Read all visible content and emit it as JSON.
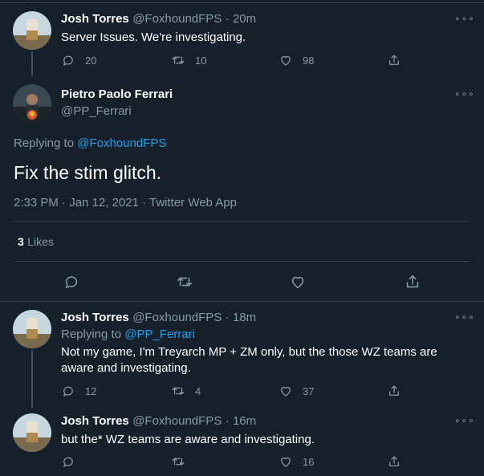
{
  "tweets": [
    {
      "name": "Josh Torres",
      "handle": "@FoxhoundFPS",
      "time": "· 20m",
      "text": "Server Issues. We're investigating.",
      "replies": "20",
      "retweets": "10",
      "likes": "98"
    },
    {
      "name": "Josh Torres",
      "handle": "@FoxhoundFPS",
      "time": "· 18m",
      "replying_prefix": "Replying to",
      "replying_to": "@PP_Ferrari",
      "text_line1": "Not my game, I'm Treyarch MP + ZM only, but the those WZ teams are",
      "text_line2": "aware and investigating.",
      "replies": "12",
      "retweets": "4",
      "likes": "37"
    },
    {
      "name": "Josh Torres",
      "handle": "@FoxhoundFPS",
      "time": "· 16m",
      "text": "but the* WZ teams are aware and investigating.",
      "replies": "",
      "retweets": "",
      "likes": "16"
    }
  ],
  "main_tweet": {
    "name": "Pietro Paolo Ferrari",
    "handle": "@PP_Ferrari",
    "replying_prefix": "Replying to",
    "replying_to": "@FoxhoundFPS",
    "text": "Fix the stim glitch.",
    "meta": "2:33 PM · Jan 12, 2021 · Twitter Web App",
    "likes_count": "3",
    "likes_label": "Likes"
  },
  "more_glyph": "∘∘∘",
  "colors": {
    "background": "#15202b",
    "separator": "#38444d",
    "secondary_text": "#8899a6",
    "link": "#1da1f2"
  },
  "icons": [
    "reply-icon",
    "retweet-icon",
    "like-icon",
    "share-icon",
    "more-icon"
  ]
}
